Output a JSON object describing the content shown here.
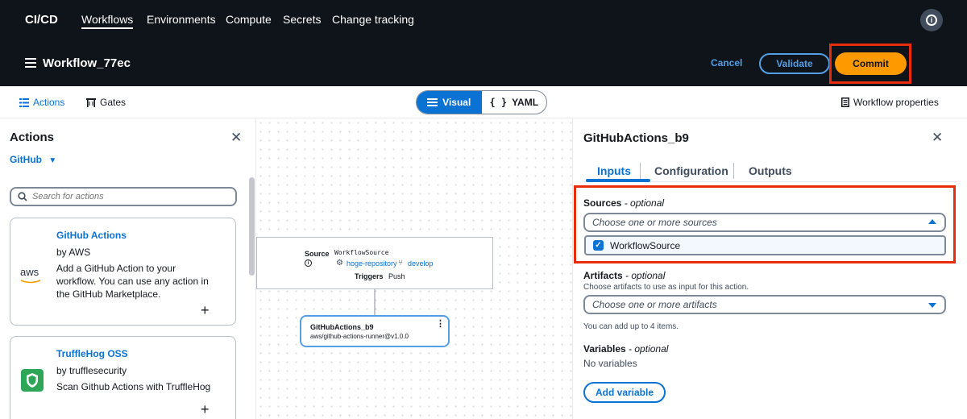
{
  "topnav": {
    "brand": "CI/CD",
    "links": [
      "Workflows",
      "Environments",
      "Compute",
      "Secrets",
      "Change tracking"
    ],
    "active_link": "Workflows",
    "info_icon": "info-icon"
  },
  "workflow": {
    "title": "Workflow_77ec",
    "cancel_label": "Cancel",
    "validate_label": "Validate",
    "commit_label": "Commit"
  },
  "toolbar": {
    "actions_label": "Actions",
    "gates_label": "Gates",
    "visual_label": "Visual",
    "yaml_label": "YAML",
    "yaml_icon": "{ }",
    "properties_label": "Workflow properties"
  },
  "actions_panel": {
    "title": "Actions",
    "filter_label": "GitHub",
    "search_placeholder": "Search for actions",
    "cards": [
      {
        "title": "GitHub Actions",
        "by": "by AWS",
        "description": "Add a GitHub Action to your workflow. You can use any action in the GitHub Marketplace.",
        "logo_text": "aws",
        "add": "+"
      },
      {
        "title": "TruffleHog OSS",
        "by": "by trufflesecurity",
        "description": "Scan Github Actions with TruffleHog",
        "logo_text": "",
        "add": "+"
      }
    ]
  },
  "canvas": {
    "source_node": {
      "label": "Source",
      "name": "WorkflowSource",
      "repo": "hoge-repository",
      "branch": "develop",
      "triggers_label": "Triggers",
      "trigger_value": "Push"
    },
    "action_node": {
      "name": "GitHubActions_b9",
      "action": "aws/github-actions-runner@v1.0.0"
    }
  },
  "details_panel": {
    "title": "GitHubActions_b9",
    "tabs": [
      "Inputs",
      "Configuration",
      "Outputs"
    ],
    "active_tab": "Inputs",
    "sources": {
      "label": "Sources",
      "optional": " - optional",
      "placeholder": "Choose one or more sources",
      "option": "WorkflowSource",
      "option_checked": true
    },
    "artifacts": {
      "label": "Artifacts",
      "optional": " - optional",
      "description": "Choose artifacts to use as input for this action.",
      "placeholder": "Choose one or more artifacts",
      "hint": "You can add up to 4 items."
    },
    "variables": {
      "label": "Variables",
      "optional": " - optional",
      "empty": "No variables",
      "add_label": "Add variable"
    }
  },
  "colors": {
    "nav_bg": "#0f141a",
    "accent_blue": "#0972d3",
    "commit_orange": "#ff9900",
    "highlight_red": "#e82c0c"
  }
}
